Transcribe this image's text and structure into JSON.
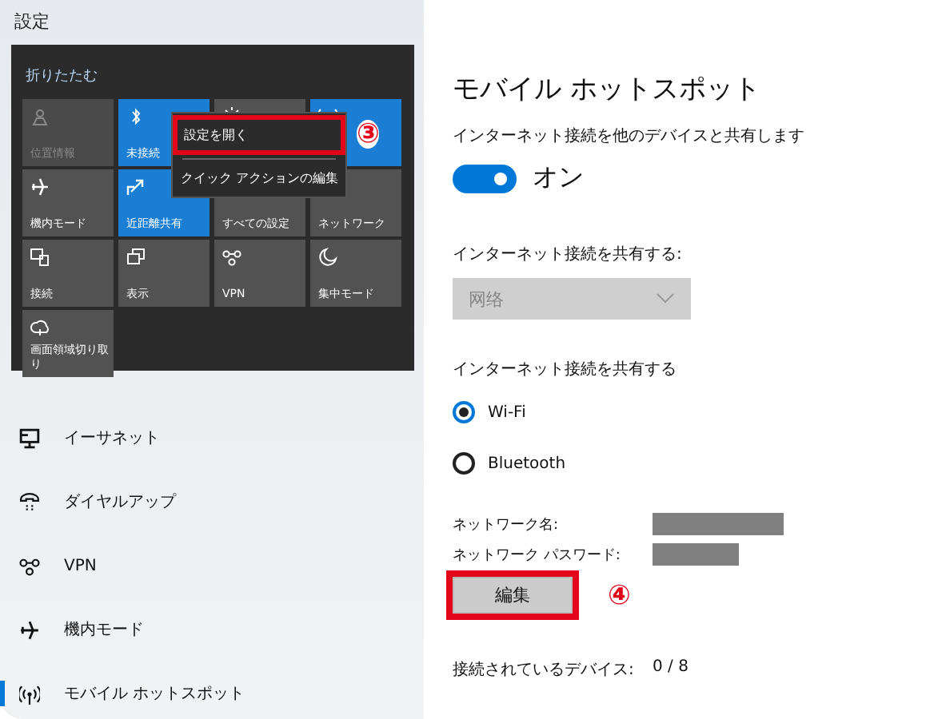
{
  "window": {
    "title": "設定"
  },
  "action_center": {
    "collapse": "折りたたむ",
    "tiles": [
      {
        "label": "位置情報",
        "active": false,
        "disabled": true
      },
      {
        "label": "未接続",
        "active": true,
        "disabled": false
      },
      {
        "active": false,
        "disabled": false
      },
      {
        "active": true,
        "disabled": false
      },
      {
        "label": "機内モード",
        "active": false,
        "disabled": false
      },
      {
        "label": "近距離共有",
        "active": true,
        "disabled": false
      },
      {
        "label": "すべての設定",
        "active": false,
        "disabled": false
      },
      {
        "label": "ネットワーク",
        "active": false,
        "disabled": false
      },
      {
        "label": "接続",
        "active": false,
        "disabled": false
      },
      {
        "label": "表示",
        "active": false,
        "disabled": false
      },
      {
        "label": "VPN",
        "active": false,
        "disabled": false
      },
      {
        "label": "集中モード",
        "active": false,
        "disabled": false
      },
      {
        "label": "画面領域切り取り",
        "active": false,
        "disabled": false
      }
    ],
    "context_menu": [
      {
        "label": "設定を開く",
        "highlighted": true,
        "callout": "③"
      },
      {
        "label": "クイック アクションの編集",
        "highlighted": false
      }
    ]
  },
  "sidebar": {
    "items": [
      {
        "label": "イーサネット",
        "selected": false
      },
      {
        "label": "ダイヤルアップ",
        "selected": false
      },
      {
        "label": "VPN",
        "selected": false
      },
      {
        "label": "機内モード",
        "selected": false
      },
      {
        "label": "モバイル ホットスポット",
        "selected": true
      }
    ]
  },
  "page": {
    "title": "モバイル ホットスポット",
    "share_label": "インターネット接続を他のデバイスと共有します",
    "toggle": {
      "on": true,
      "label": "オン"
    },
    "source_label": "インターネット接続を共有する:",
    "source_dropdown": {
      "value": "网络",
      "disabled": true
    },
    "via_label": "インターネット接続を共有する",
    "via_options": [
      {
        "label": "Wi-Fi",
        "selected": true
      },
      {
        "label": "Bluetooth",
        "selected": false
      }
    ],
    "fields": [
      {
        "label": "ネットワーク名:",
        "masked": true
      },
      {
        "label": "ネットワーク パスワード:",
        "masked": true
      }
    ],
    "edit_button": {
      "label": "編集",
      "highlighted": true,
      "callout": "④"
    },
    "devices": {
      "label": "接続されているデバイス:",
      "value": "0 / 8"
    }
  }
}
